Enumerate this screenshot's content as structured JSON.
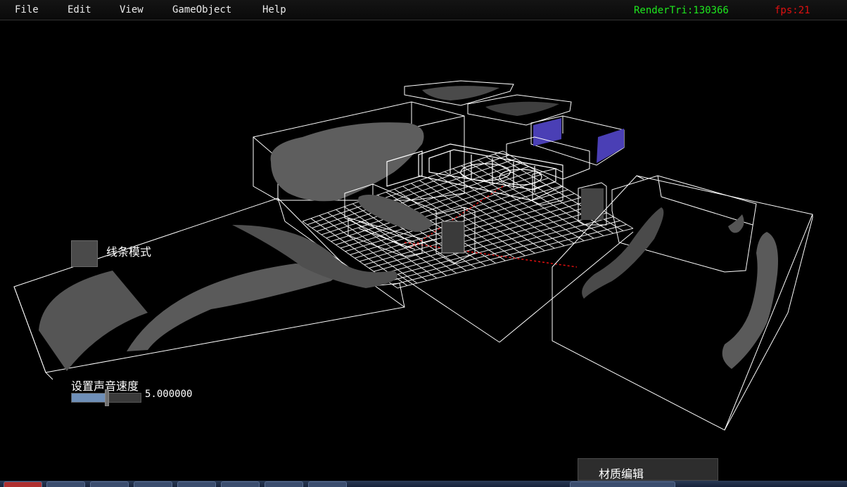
{
  "menu": {
    "items": [
      "File",
      "Edit",
      "View",
      "GameObject",
      "Help"
    ]
  },
  "stats": {
    "render_tri_label": "RenderTri:130366",
    "fps_label": "fps:21"
  },
  "colors": {
    "stat_render": "#1ee81e",
    "stat_fps": "#e01010",
    "wire": "#ffffff",
    "grid_axis": "#e01010",
    "highlight_face": "#4a3fb5"
  },
  "controls": {
    "wireframe_mode_label": "线条模式",
    "wireframe_mode_checked": false,
    "sound_speed_label": "设置声音速度",
    "sound_speed_value": "5.000000",
    "sound_speed_fraction": 0.5
  },
  "panel": {
    "material_editor_label": "材质编辑"
  }
}
